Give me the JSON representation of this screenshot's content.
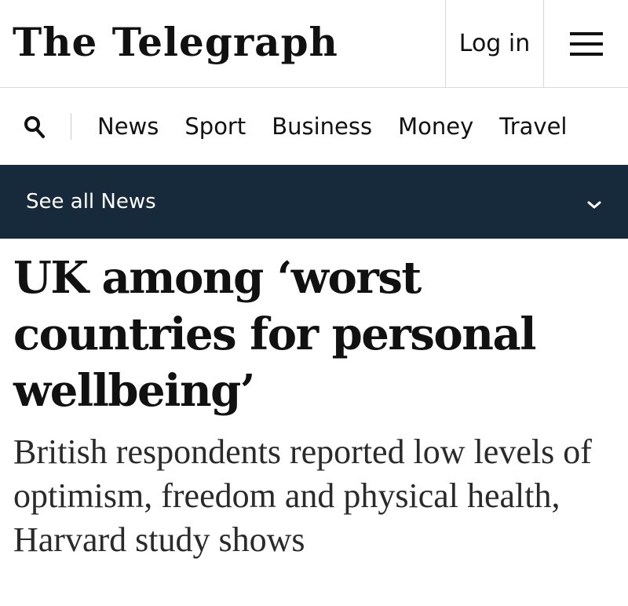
{
  "header": {
    "logo_text": "The Telegraph",
    "login_label": "Log in",
    "menu_icon": "hamburger-menu-icon"
  },
  "nav": {
    "search_icon": "search-icon",
    "items": [
      {
        "label": "News"
      },
      {
        "label": "Sport"
      },
      {
        "label": "Business"
      },
      {
        "label": "Money"
      },
      {
        "label": "Travel"
      }
    ]
  },
  "section_bar": {
    "label": "See all News",
    "icon": "chevron-down-icon",
    "background": "#162a3c"
  },
  "article": {
    "headline": "UK among ‘worst countries for personal wellbeing’",
    "standfirst": "British respondents reported low levels of optimism, freedom and physical health, Harvard study shows"
  }
}
